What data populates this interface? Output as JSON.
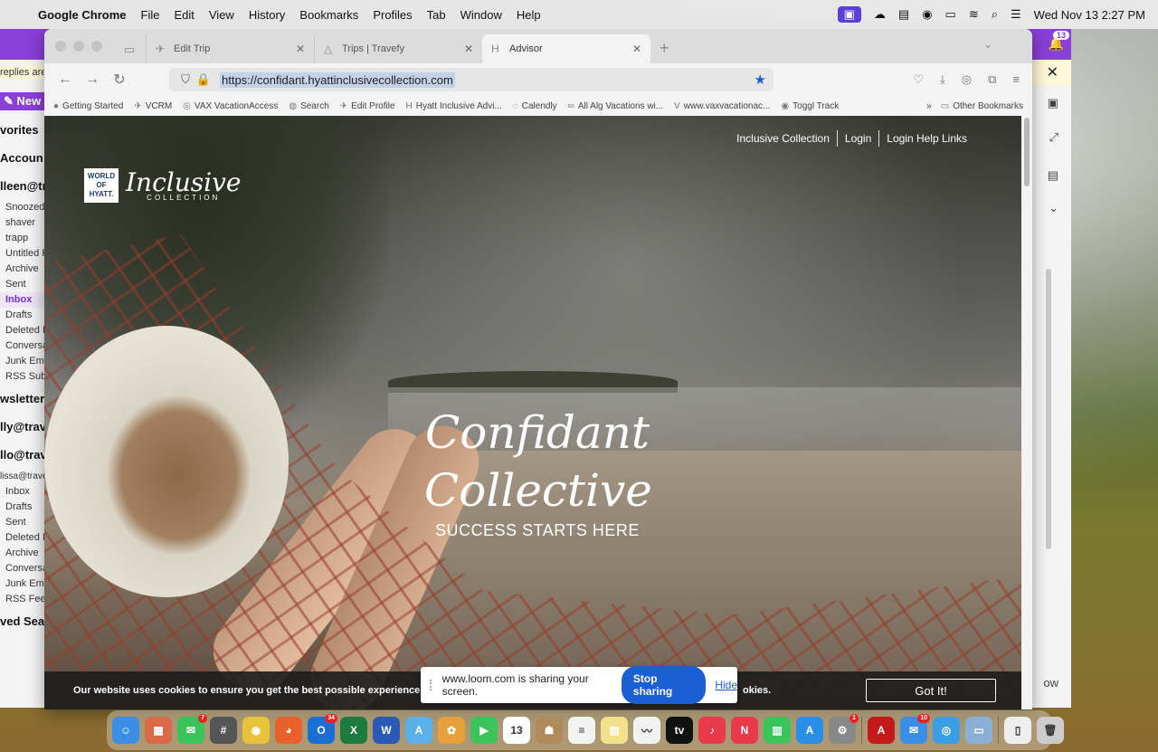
{
  "menubar": {
    "app": "Google Chrome",
    "items": [
      "File",
      "Edit",
      "View",
      "History",
      "Bookmarks",
      "Profiles",
      "Tab",
      "Window",
      "Help"
    ],
    "clock": "Wed Nov 13  2:27 PM"
  },
  "mail": {
    "notice": "replies are",
    "new_label": "New",
    "folders": [
      {
        "label": "vorites",
        "type": "hdr"
      },
      {
        "label": "Accoun",
        "type": "hdr"
      },
      {
        "label": "lleen@tr",
        "type": "hdr"
      },
      {
        "label": "Snoozed",
        "type": "item"
      },
      {
        "label": "shaver",
        "type": "item"
      },
      {
        "label": "trapp",
        "type": "item"
      },
      {
        "label": "Untitled F",
        "type": "item"
      },
      {
        "label": "Archive",
        "type": "item"
      },
      {
        "label": "Sent",
        "type": "item"
      },
      {
        "label": "Inbox",
        "type": "sel"
      },
      {
        "label": "Drafts",
        "type": "item"
      },
      {
        "label": "Deleted I",
        "type": "item"
      },
      {
        "label": "Conversa",
        "type": "item"
      },
      {
        "label": "Junk Ema",
        "type": "item"
      },
      {
        "label": "RSS Subs",
        "type": "item"
      },
      {
        "label": "wsletter",
        "type": "hdr"
      },
      {
        "label": "lly@trav",
        "type": "hdr"
      },
      {
        "label": "llo@trav",
        "type": "hdr"
      },
      {
        "label": "lissa@trave",
        "type": "small"
      },
      {
        "label": "Inbox",
        "type": "item"
      },
      {
        "label": "Drafts",
        "type": "item"
      },
      {
        "label": "Sent",
        "type": "item"
      },
      {
        "label": "Deleted I",
        "type": "item"
      },
      {
        "label": "Archive",
        "type": "item"
      },
      {
        "label": "Conversa",
        "type": "item"
      },
      {
        "label": "Junk Ema",
        "type": "item"
      },
      {
        "label": "RSS Feed",
        "type": "item"
      },
      {
        "label": "ved Sea",
        "type": "hdr"
      }
    ],
    "notification_count": "13",
    "right_snippet": "ow"
  },
  "tabs": [
    {
      "label": "Edit Trip",
      "icon": "✈",
      "active": false
    },
    {
      "label": "Trips | Travefy",
      "icon": "△",
      "active": false
    },
    {
      "label": "Advisor",
      "icon": "H",
      "active": true
    }
  ],
  "address": {
    "url": "https://confidant.hyattinclusivecollection.com"
  },
  "bookmarks": [
    {
      "label": "Getting Started",
      "icon": "●"
    },
    {
      "label": "VCRM",
      "icon": "✈"
    },
    {
      "label": "VAX VacationAccess",
      "icon": "◎"
    },
    {
      "label": "Search",
      "icon": "◍"
    },
    {
      "label": "Edit Profile",
      "icon": "✈"
    },
    {
      "label": "Hyatt Inclusive Advi...",
      "icon": "H"
    },
    {
      "label": "Calendly",
      "icon": "◌"
    },
    {
      "label": "All Alg Vacations wi...",
      "icon": "∞"
    },
    {
      "label": "www.vaxvacationac...",
      "icon": "V"
    },
    {
      "label": "Toggl Track",
      "icon": "◉"
    }
  ],
  "bookmarks_more": "Other Bookmarks",
  "site": {
    "nav": [
      "Inclusive Collection",
      "Login",
      "Login Help Links"
    ],
    "logo_lines": [
      "WORLD",
      "OF",
      "HYATT."
    ],
    "logo_script": "Inclusive",
    "logo_sub": "COLLECTION",
    "hero_line1": "Confidant",
    "hero_line2": "Collective",
    "hero_tagline": "SUCCESS STARTS HERE",
    "cookie_text": "Our website uses cookies to ensure you get the best possible experience o",
    "cookie_text_end": "okies.",
    "cookie_button": "Got It!"
  },
  "loom": {
    "message": "www.loom.com is sharing your screen.",
    "stop_label": "Stop sharing",
    "hide_label": "Hide"
  },
  "dock": [
    {
      "name": "finder",
      "color": "#3a8ee6",
      "glyph": "☺"
    },
    {
      "name": "launchpad",
      "color": "#d86a4a",
      "glyph": "▦"
    },
    {
      "name": "messages",
      "color": "#3ac45a",
      "glyph": "✉",
      "badge": "7"
    },
    {
      "name": "calculator",
      "color": "#555555",
      "glyph": "#"
    },
    {
      "name": "chrome",
      "color": "#e8c23a",
      "glyph": "◉"
    },
    {
      "name": "firefox",
      "color": "#e8602a",
      "glyph": "◕"
    },
    {
      "name": "outlook",
      "color": "#1a6fd4",
      "glyph": "O",
      "badge": "34"
    },
    {
      "name": "excel",
      "color": "#1d7a3e",
      "glyph": "X"
    },
    {
      "name": "word",
      "color": "#2a5bb4",
      "glyph": "W"
    },
    {
      "name": "maps",
      "color": "#5ab0e8",
      "glyph": "A"
    },
    {
      "name": "photos",
      "color": "#e8a03a",
      "glyph": "✿"
    },
    {
      "name": "facetime",
      "color": "#3ac45a",
      "glyph": "▶"
    },
    {
      "name": "calendar",
      "color": "#ffffff",
      "glyph": "13"
    },
    {
      "name": "contacts",
      "color": "#b08a5a",
      "glyph": "☗"
    },
    {
      "name": "reminders",
      "color": "#f2f2f2",
      "glyph": "≡"
    },
    {
      "name": "notes",
      "color": "#f2e08a",
      "glyph": "▤"
    },
    {
      "name": "freeform",
      "color": "#f2f2f2",
      "glyph": "〰"
    },
    {
      "name": "tv",
      "color": "#111111",
      "glyph": "tv"
    },
    {
      "name": "music",
      "color": "#e83a4a",
      "glyph": "♪"
    },
    {
      "name": "news",
      "color": "#e83a4a",
      "glyph": "N"
    },
    {
      "name": "numbers",
      "color": "#3ac45a",
      "glyph": "▥"
    },
    {
      "name": "app-store",
      "color": "#2a8ee6",
      "glyph": "A"
    },
    {
      "name": "system-settings",
      "color": "#888888",
      "glyph": "⚙",
      "badge": "1"
    },
    {
      "name": "acrobat",
      "color": "#c41a1a",
      "glyph": "A"
    },
    {
      "name": "mail",
      "color": "#3a8ee6",
      "glyph": "✉",
      "badge": "10"
    },
    {
      "name": "safari",
      "color": "#3a9ee6",
      "glyph": "◎"
    },
    {
      "name": "preview",
      "color": "#8ab0d8",
      "glyph": "▭"
    },
    {
      "name": "documents",
      "color": "#eeeeee",
      "glyph": "▯"
    },
    {
      "name": "trash",
      "color": "#cccccc",
      "glyph": "🗑"
    }
  ]
}
